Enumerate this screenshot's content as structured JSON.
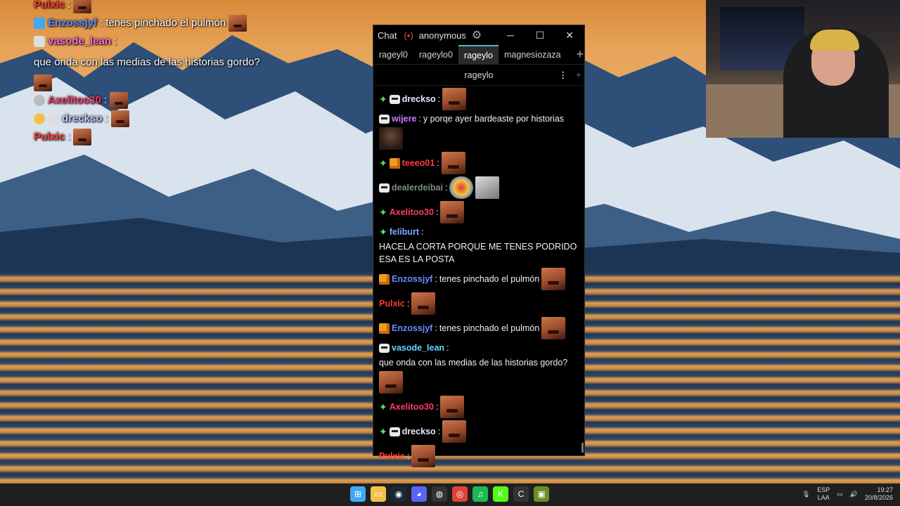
{
  "overlay_chat": [
    {
      "user": "Pulxic",
      "user_color": "#ff3b30",
      "text": "",
      "emote": true
    },
    {
      "user": "Enzossjyf",
      "user_color": "#5b8cff",
      "text": "tenes pinchado el pulmón",
      "emote": true
    },
    {
      "user": "vasode_lean",
      "user_color": "#ff6bd1",
      "text": "que onda con las medias de las historias gordo?",
      "emote": true
    },
    {
      "user": "Axelitoo30",
      "user_color": "#ff3b6b",
      "text": "",
      "emote": true
    },
    {
      "user": "drecksо",
      "user_color": "#b9c8ff",
      "text": "",
      "emote": true
    },
    {
      "user": "Pulxic",
      "user_color": "#ff3b30",
      "text": "",
      "emote": true
    }
  ],
  "window": {
    "app_title": "Chat",
    "live_icon": "(•)",
    "account": "anonymous",
    "gear_icon": "⚙",
    "min": "─",
    "max": "☐",
    "close": "✕",
    "tabs": [
      "rageyl0",
      "rageylo0",
      "rageylo",
      "magnesiozaza"
    ],
    "active_tab": "rageylo",
    "tab_add": "+",
    "channel": "rageylo",
    "channel_more": "⋮",
    "channel_add": "+"
  },
  "messages": [
    {
      "badge": "star",
      "mask": true,
      "user": "drecksо",
      "color": "#e8e8ff",
      "text": "",
      "pics": [
        "emote"
      ]
    },
    {
      "badge": "",
      "mask": true,
      "user": "wijere",
      "color": "#d07aff",
      "text": "y porqe ayer bardeaste por historias",
      "pics": [
        "face"
      ]
    },
    {
      "badge": "star",
      "mask": false,
      "box": true,
      "user": "teeeo01",
      "color": "#ff3b3b",
      "text": "",
      "pics": [
        "emote"
      ]
    },
    {
      "badge": "",
      "mask": true,
      "user": "dealerdeibai",
      "color": "#7a8f7a",
      "text": "",
      "pics": [
        "clown",
        "gray"
      ]
    },
    {
      "badge": "star",
      "mask": false,
      "user": "Axelitoo30",
      "color": "#ff3b6b",
      "text": "",
      "pics": [
        "emote"
      ]
    },
    {
      "badge": "star",
      "mask": false,
      "user": "feliburt",
      "color": "#7aa8ff",
      "text": "HACELA CORTA PORQUE ME TENES PODRIDO ESA ES LA POSTA",
      "pics": []
    },
    {
      "badge": "",
      "box": true,
      "user": "Enzossjyf",
      "color": "#6a8cff",
      "text": "tenes pinchado el pulmón",
      "pics": [
        "emote"
      ]
    },
    {
      "badge": "",
      "user": "Pulxic",
      "color": "#ff3b30",
      "text": "",
      "pics": [
        "emote"
      ]
    },
    {
      "badge": "",
      "box": true,
      "user": "Enzossjyf",
      "color": "#6a8cff",
      "text": "tenes pinchado el pulmón",
      "pics": [
        "emote"
      ]
    },
    {
      "badge": "",
      "mask": true,
      "user": "vasode_lean",
      "color": "#6ad0ff",
      "text": "que onda con las medias de las historias gordo?",
      "pics": [
        "emote"
      ]
    },
    {
      "badge": "star",
      "user": "Axelitoo30",
      "color": "#ff3b6b",
      "text": "",
      "pics": [
        "emote"
      ]
    },
    {
      "badge": "star",
      "mask": true,
      "user": "drecksо",
      "color": "#e8e8ff",
      "text": "",
      "pics": [
        "emote"
      ]
    },
    {
      "badge": "",
      "user": "Pulxic",
      "color": "#ff3b30",
      "text": "",
      "pics": [
        "emote"
      ]
    }
  ],
  "taskbar": {
    "icons": [
      {
        "name": "start-icon",
        "glyph": "⊞",
        "color": "#3fa9f5"
      },
      {
        "name": "file-explorer-icon",
        "glyph": "▭",
        "color": "#f2c14a"
      },
      {
        "name": "steam-icon",
        "glyph": "◉",
        "color": "#1b2838"
      },
      {
        "name": "discord-icon",
        "glyph": "◕",
        "color": "#5865f2"
      },
      {
        "name": "obs-icon",
        "glyph": "◍",
        "color": "#333"
      },
      {
        "name": "chrome-icon",
        "glyph": "◎",
        "color": "#db4437"
      },
      {
        "name": "spotify-icon",
        "glyph": "♫",
        "color": "#1db954"
      },
      {
        "name": "kick-icon",
        "glyph": "K",
        "color": "#53fc18"
      },
      {
        "name": "chatterino-icon",
        "glyph": "C",
        "color": "#333"
      },
      {
        "name": "app-icon",
        "glyph": "▣",
        "color": "#6b8e23"
      }
    ],
    "lang_top": "ESP",
    "lang_bottom": "LAA",
    "time": "19:27",
    "date": "20/8/2026"
  }
}
